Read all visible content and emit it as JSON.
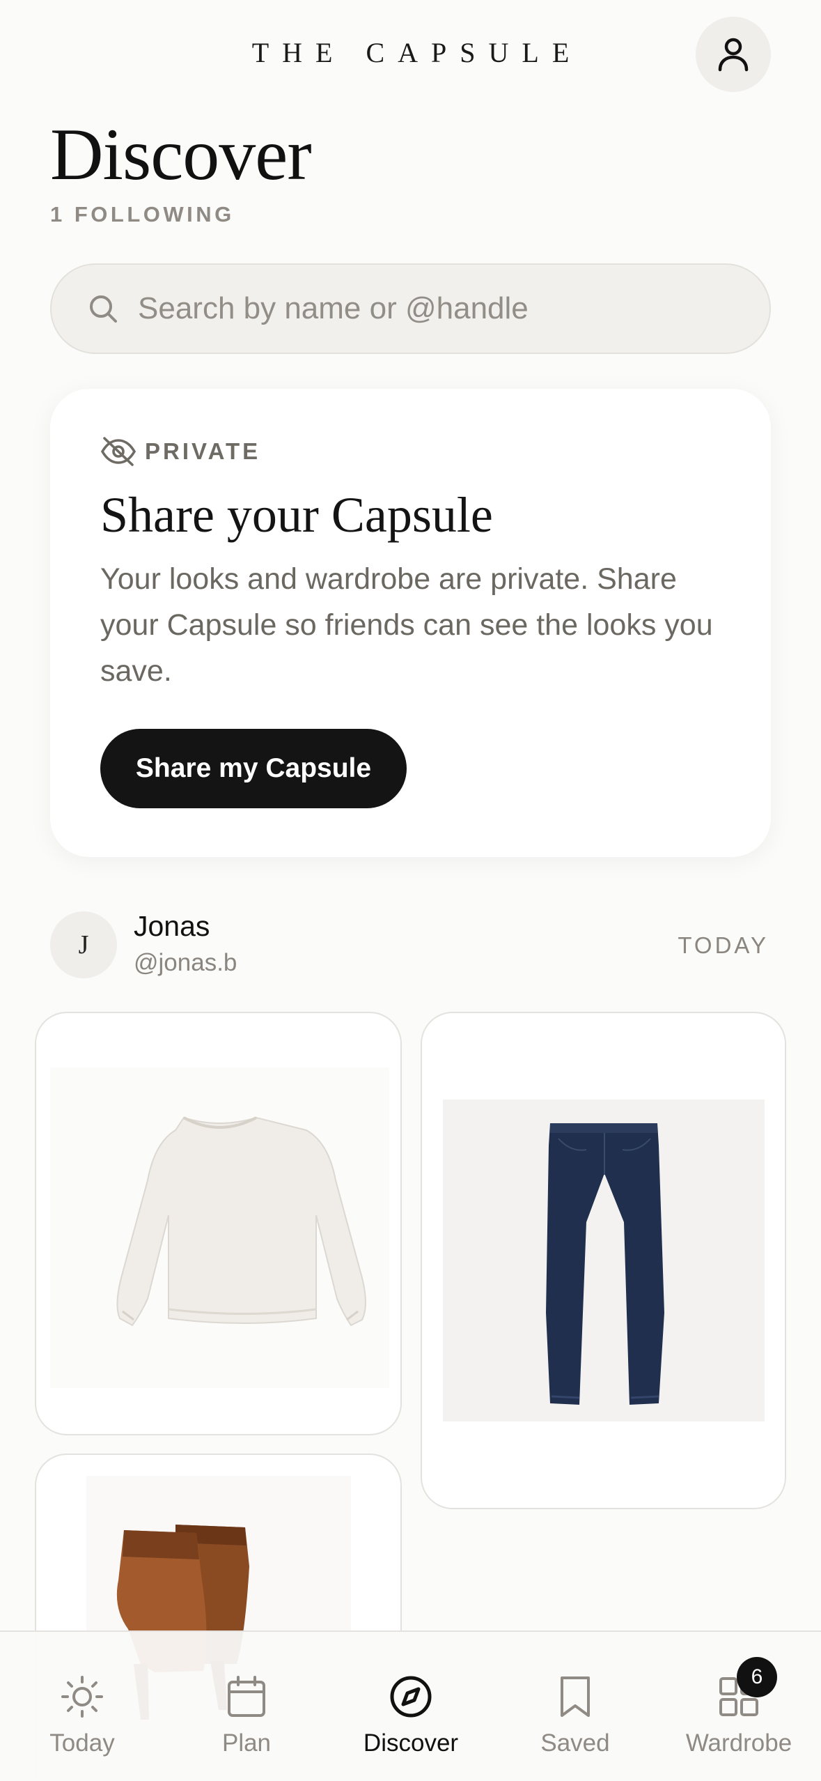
{
  "header": {
    "brand": "THE CAPSULE",
    "profile_icon": "user-icon"
  },
  "page": {
    "title": "Discover",
    "following": "1 FOLLOWING"
  },
  "search": {
    "placeholder": "Search by name or @handle",
    "value": "",
    "icon": "search-icon"
  },
  "share_card": {
    "badge_icon": "eye-off-icon",
    "badge_label": "PRIVATE",
    "title": "Share your Capsule",
    "description": "Your looks and wardrobe are private. Share your Capsule so friends can see the looks you save.",
    "button_label": "Share my Capsule"
  },
  "feed": {
    "user": {
      "initial": "J",
      "name": "Jonas",
      "handle": "@jonas.b"
    },
    "time": "TODAY",
    "items": [
      {
        "kind": "sweater",
        "color": "#efece6"
      },
      {
        "kind": "jeans",
        "color": "#1f2f4d"
      },
      {
        "kind": "ankle-boots",
        "color": "#8a4a22"
      }
    ]
  },
  "tabbar": {
    "active": "Discover",
    "tabs": [
      {
        "label": "Today",
        "icon": "sun-icon"
      },
      {
        "label": "Plan",
        "icon": "calendar-icon"
      },
      {
        "label": "Discover",
        "icon": "compass-icon"
      },
      {
        "label": "Saved",
        "icon": "bookmark-icon"
      },
      {
        "label": "Wardrobe",
        "icon": "grid-icon",
        "badge": "6"
      }
    ]
  },
  "colors": {
    "accent": "#141414",
    "background": "#fbfbfa",
    "muted": "#8f8a84"
  }
}
